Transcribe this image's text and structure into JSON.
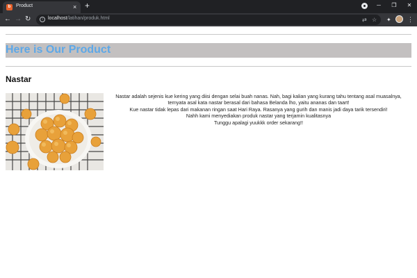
{
  "browser": {
    "tab_title": "Product",
    "tab_favicon_letter": "b",
    "url_host": "localhost",
    "url_path": "/latihan/produk.html",
    "icons": {
      "new_tab": "+",
      "close_tab": "×",
      "back": "←",
      "forward": "→",
      "reload": "↻",
      "site_info": "i",
      "translate": "⇄",
      "bookmark": "☆",
      "extensions": "✦",
      "menu": "⋮",
      "minimize": "─",
      "restore": "❐",
      "close_window": "✕"
    }
  },
  "page": {
    "banner_title": "Here is Our Product",
    "banner_color": "#c3c0c0",
    "title_color": "#5da8e8",
    "product": {
      "name": "Nastar",
      "description_lines": [
        "Nastar adalah sejenis kue kering yang diisi dengan selai buah nanas. Nah, bagi kalian yang kurang tahu tentang asal muasalnya,",
        "ternyata asal kata nastar berasal dari bahasa Belanda lho, yaitu ananas dan taart!",
        "Kue nastar tidak lepas dari makanan ringan saat Hari Raya. Rasanya yang gurih dan manis jadi daya tarik tersendiri!",
        "Nahh kami menyediakan produk nastar yang terjamin kualitasnya",
        "Tunggu apalagi yuukkk order sekarang!!"
      ]
    }
  }
}
